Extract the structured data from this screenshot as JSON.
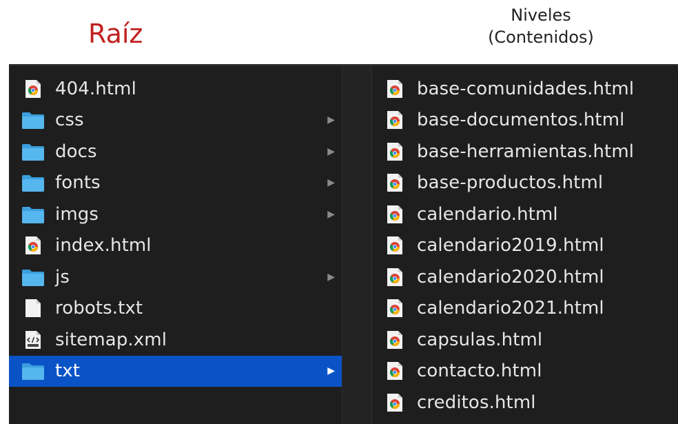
{
  "header": {
    "root_label": "Raíz",
    "levels_label_line1": "Niveles",
    "levels_label_line2": "(Contenidos)"
  },
  "colors": {
    "root_label": "#c0211f",
    "browser_bg": "#1e1e1f",
    "selection": "#0a53c7",
    "folder": "#4aaee8"
  },
  "left_column": [
    {
      "name": "404.html",
      "icon": "chrome-file-icon",
      "has_children": false,
      "selected": false
    },
    {
      "name": "css",
      "icon": "folder-icon",
      "has_children": true,
      "selected": false
    },
    {
      "name": "docs",
      "icon": "folder-icon",
      "has_children": true,
      "selected": false
    },
    {
      "name": "fonts",
      "icon": "folder-icon",
      "has_children": true,
      "selected": false
    },
    {
      "name": "imgs",
      "icon": "folder-icon",
      "has_children": true,
      "selected": false
    },
    {
      "name": "index.html",
      "icon": "chrome-file-icon",
      "has_children": false,
      "selected": false
    },
    {
      "name": "js",
      "icon": "folder-icon",
      "has_children": true,
      "selected": false
    },
    {
      "name": "robots.txt",
      "icon": "text-file-icon",
      "has_children": false,
      "selected": false
    },
    {
      "name": "sitemap.xml",
      "icon": "xml-file-icon",
      "has_children": false,
      "selected": false
    },
    {
      "name": "txt",
      "icon": "folder-icon",
      "has_children": true,
      "selected": true
    }
  ],
  "right_column": [
    {
      "name": "base-comunidades.html",
      "icon": "chrome-file-icon"
    },
    {
      "name": "base-documentos.html",
      "icon": "chrome-file-icon"
    },
    {
      "name": "base-herramientas.html",
      "icon": "chrome-file-icon"
    },
    {
      "name": "base-productos.html",
      "icon": "chrome-file-icon"
    },
    {
      "name": "calendario.html",
      "icon": "chrome-file-icon"
    },
    {
      "name": "calendario2019.html",
      "icon": "chrome-file-icon"
    },
    {
      "name": "calendario2020.html",
      "icon": "chrome-file-icon"
    },
    {
      "name": "calendario2021.html",
      "icon": "chrome-file-icon"
    },
    {
      "name": "capsulas.html",
      "icon": "chrome-file-icon"
    },
    {
      "name": "contacto.html",
      "icon": "chrome-file-icon"
    },
    {
      "name": "creditos.html",
      "icon": "chrome-file-icon"
    }
  ]
}
